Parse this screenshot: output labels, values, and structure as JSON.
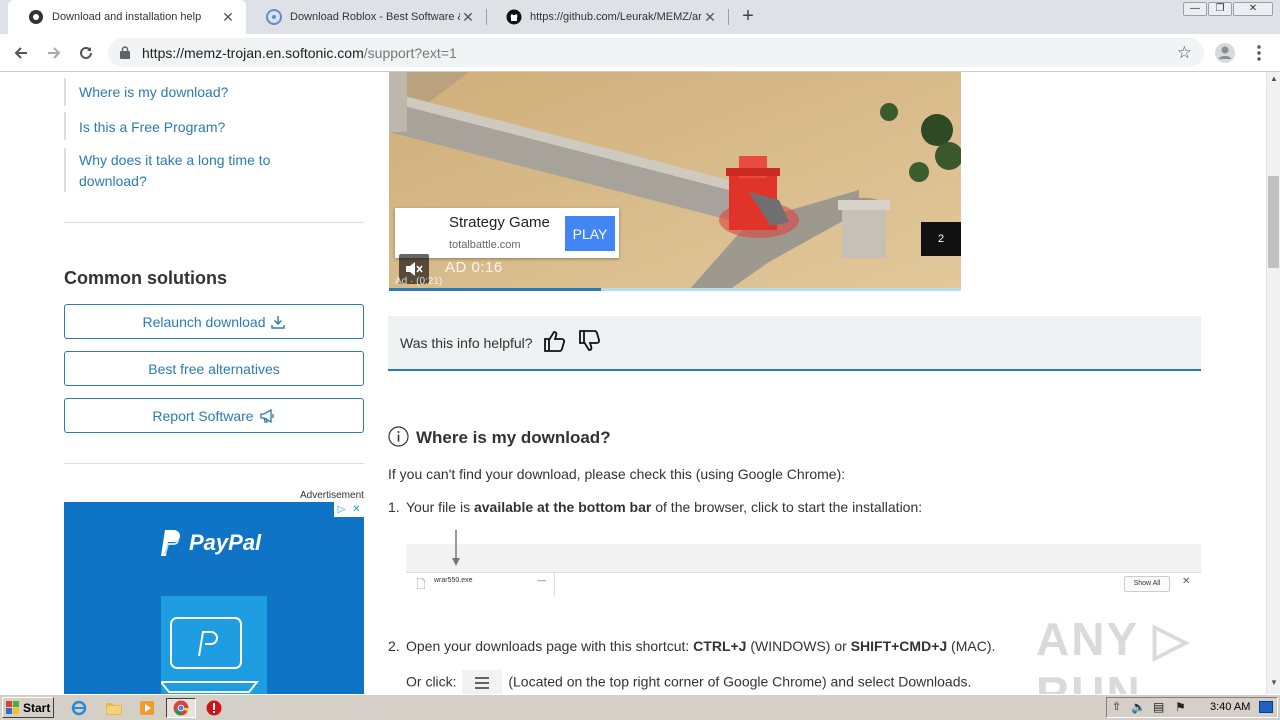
{
  "browser": {
    "tabs": [
      {
        "title": "Download and installation help",
        "active": true,
        "icon": "softonic-icon"
      },
      {
        "title": "Download Roblox - Best Software &",
        "active": false,
        "icon": "softonic-icon"
      },
      {
        "title": "https://github.com/Leurak/MEMZ/ar",
        "active": false,
        "icon": "github-icon"
      }
    ],
    "new_tab": "+",
    "close_glyph": "✕",
    "url_host": "https://memz-trojan.en.softonic.com",
    "url_path": "/support?ext=1"
  },
  "sidebar": {
    "links": [
      "Where is my download?",
      "Is this a Free Program?",
      "Why does it take a long time to download?"
    ],
    "common_solutions_title": "Common solutions",
    "buttons": [
      "Relaunch download",
      "Best free alternatives",
      "Report Software"
    ],
    "advertisement_label": "Advertisement",
    "paypal_word": "PayPal"
  },
  "video_ad": {
    "card_title": "Strategy Game",
    "card_domain": "totalbattle.com",
    "play_label": "PLAY",
    "timer": "AD  0:16",
    "small_label": "Ad · (0:21)",
    "skip_count": "2",
    "progress_fraction": 0.37
  },
  "helpful": {
    "question": "Was this info helpful?"
  },
  "article": {
    "title": "Where is my download?",
    "intro": "If you can't find your download, please check this (using Google Chrome):",
    "step1_num": "1.",
    "step1_pre": "Your file is ",
    "step1_bold": "available at the bottom bar",
    "step1_post": " of the browser, click to start the installation:",
    "screenshot_file": "wrar550.exe",
    "screenshot_dash": "—",
    "screenshot_show_all": "Show All",
    "screenshot_close": "✕",
    "step2_num": "2.",
    "step2_a": "Open your downloads page with this shortcut: ",
    "step2_b": "CTRL+J",
    "step2_c": " (WINDOWS) or ",
    "step2_d": "SHIFT+CMD+J",
    "step2_e": " (MAC).",
    "step2_or": "Or click: ",
    "step2_after": " (Located on the top right corner of Google Chrome) and select Downloads."
  },
  "watermark": "ANY ▷ RUN",
  "taskbar": {
    "start_label": "Start",
    "clock": "3:40 AM"
  },
  "colors": {
    "accent": "#2a7bb4",
    "ad_play": "#4285f4",
    "paypal_bg": "#0f74c5"
  }
}
